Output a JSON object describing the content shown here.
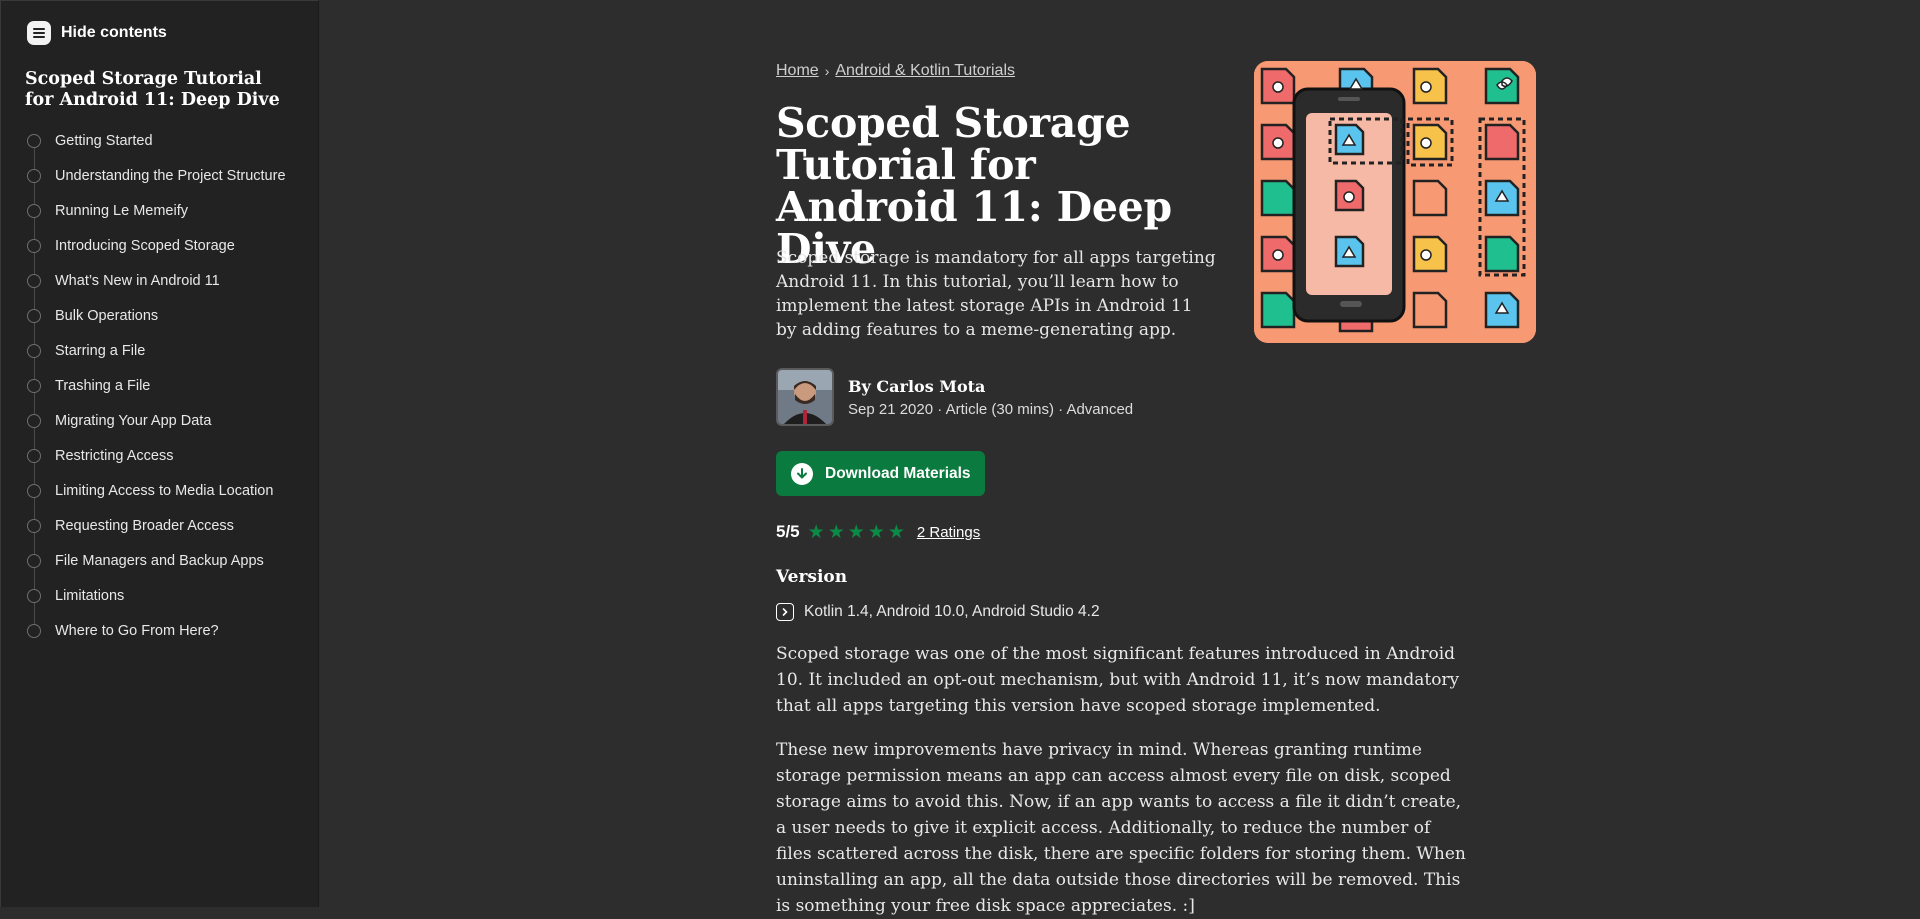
{
  "sidebar": {
    "hide_label": "Hide contents",
    "title": "Scoped Storage Tutorial for Android 11: Deep Dive",
    "items": [
      {
        "label": "Getting Started"
      },
      {
        "label": "Understanding the Project Structure"
      },
      {
        "label": "Running Le Memeify"
      },
      {
        "label": "Introducing Scoped Storage"
      },
      {
        "label": "What’s New in Android 11"
      },
      {
        "label": "Bulk Operations"
      },
      {
        "label": "Starring a File"
      },
      {
        "label": "Trashing a File"
      },
      {
        "label": "Migrating Your App Data"
      },
      {
        "label": "Restricting Access"
      },
      {
        "label": "Limiting Access to Media Location"
      },
      {
        "label": "Requesting Broader Access"
      },
      {
        "label": "File Managers and Backup Apps"
      },
      {
        "label": "Limitations"
      },
      {
        "label": "Where to Go From Here?"
      }
    ]
  },
  "breadcrumb": {
    "home": "Home",
    "separator": "›",
    "category": "Android & Kotlin Tutorials"
  },
  "article": {
    "title": "Scoped Storage Tutorial for Android 11: Deep Dive",
    "subtitle": "Scoped storage is mandatory for all apps targeting Android 11. In this tutorial, you’ll learn how to implement the latest storage APIs in Android 11 by adding features to a meme-generating app.",
    "author": {
      "by": "By",
      "name": "Carlos Mota",
      "meta": "Sep 21 2020 · Article (30 mins) · Advanced"
    },
    "download_label": "Download Materials",
    "rating": {
      "score": "5/5",
      "stars": 5,
      "ratings_label": "2 Ratings"
    },
    "version": {
      "heading": "Version",
      "text": "Kotlin 1.4, Android 10.0, Android Studio 4.2"
    },
    "paragraphs": [
      "Scoped storage was one of the most significant features introduced in Android 10. It included an opt-out mechanism, but with Android 11, it’s now mandatory that all apps targeting this version have scoped storage implemented.",
      "These new improvements have privacy in mind. Whereas granting runtime storage permission means an app can access almost every file on disk, scoped storage aims to avoid this. Now, if an app wants to access a file it didn’t create, a user needs to give it explicit access. Additionally, to reduce the number of files scattered across the disk, there are specific folders for storing them. When uninstalling an app, all the data outside those directories will be removed. This is something your free disk space appreciates. :]"
    ]
  },
  "colors": {
    "background": "#2d2d2d",
    "sidebar": "#222222",
    "accent_green": "#0b7a3e",
    "hero_bg": "#f79a74"
  }
}
